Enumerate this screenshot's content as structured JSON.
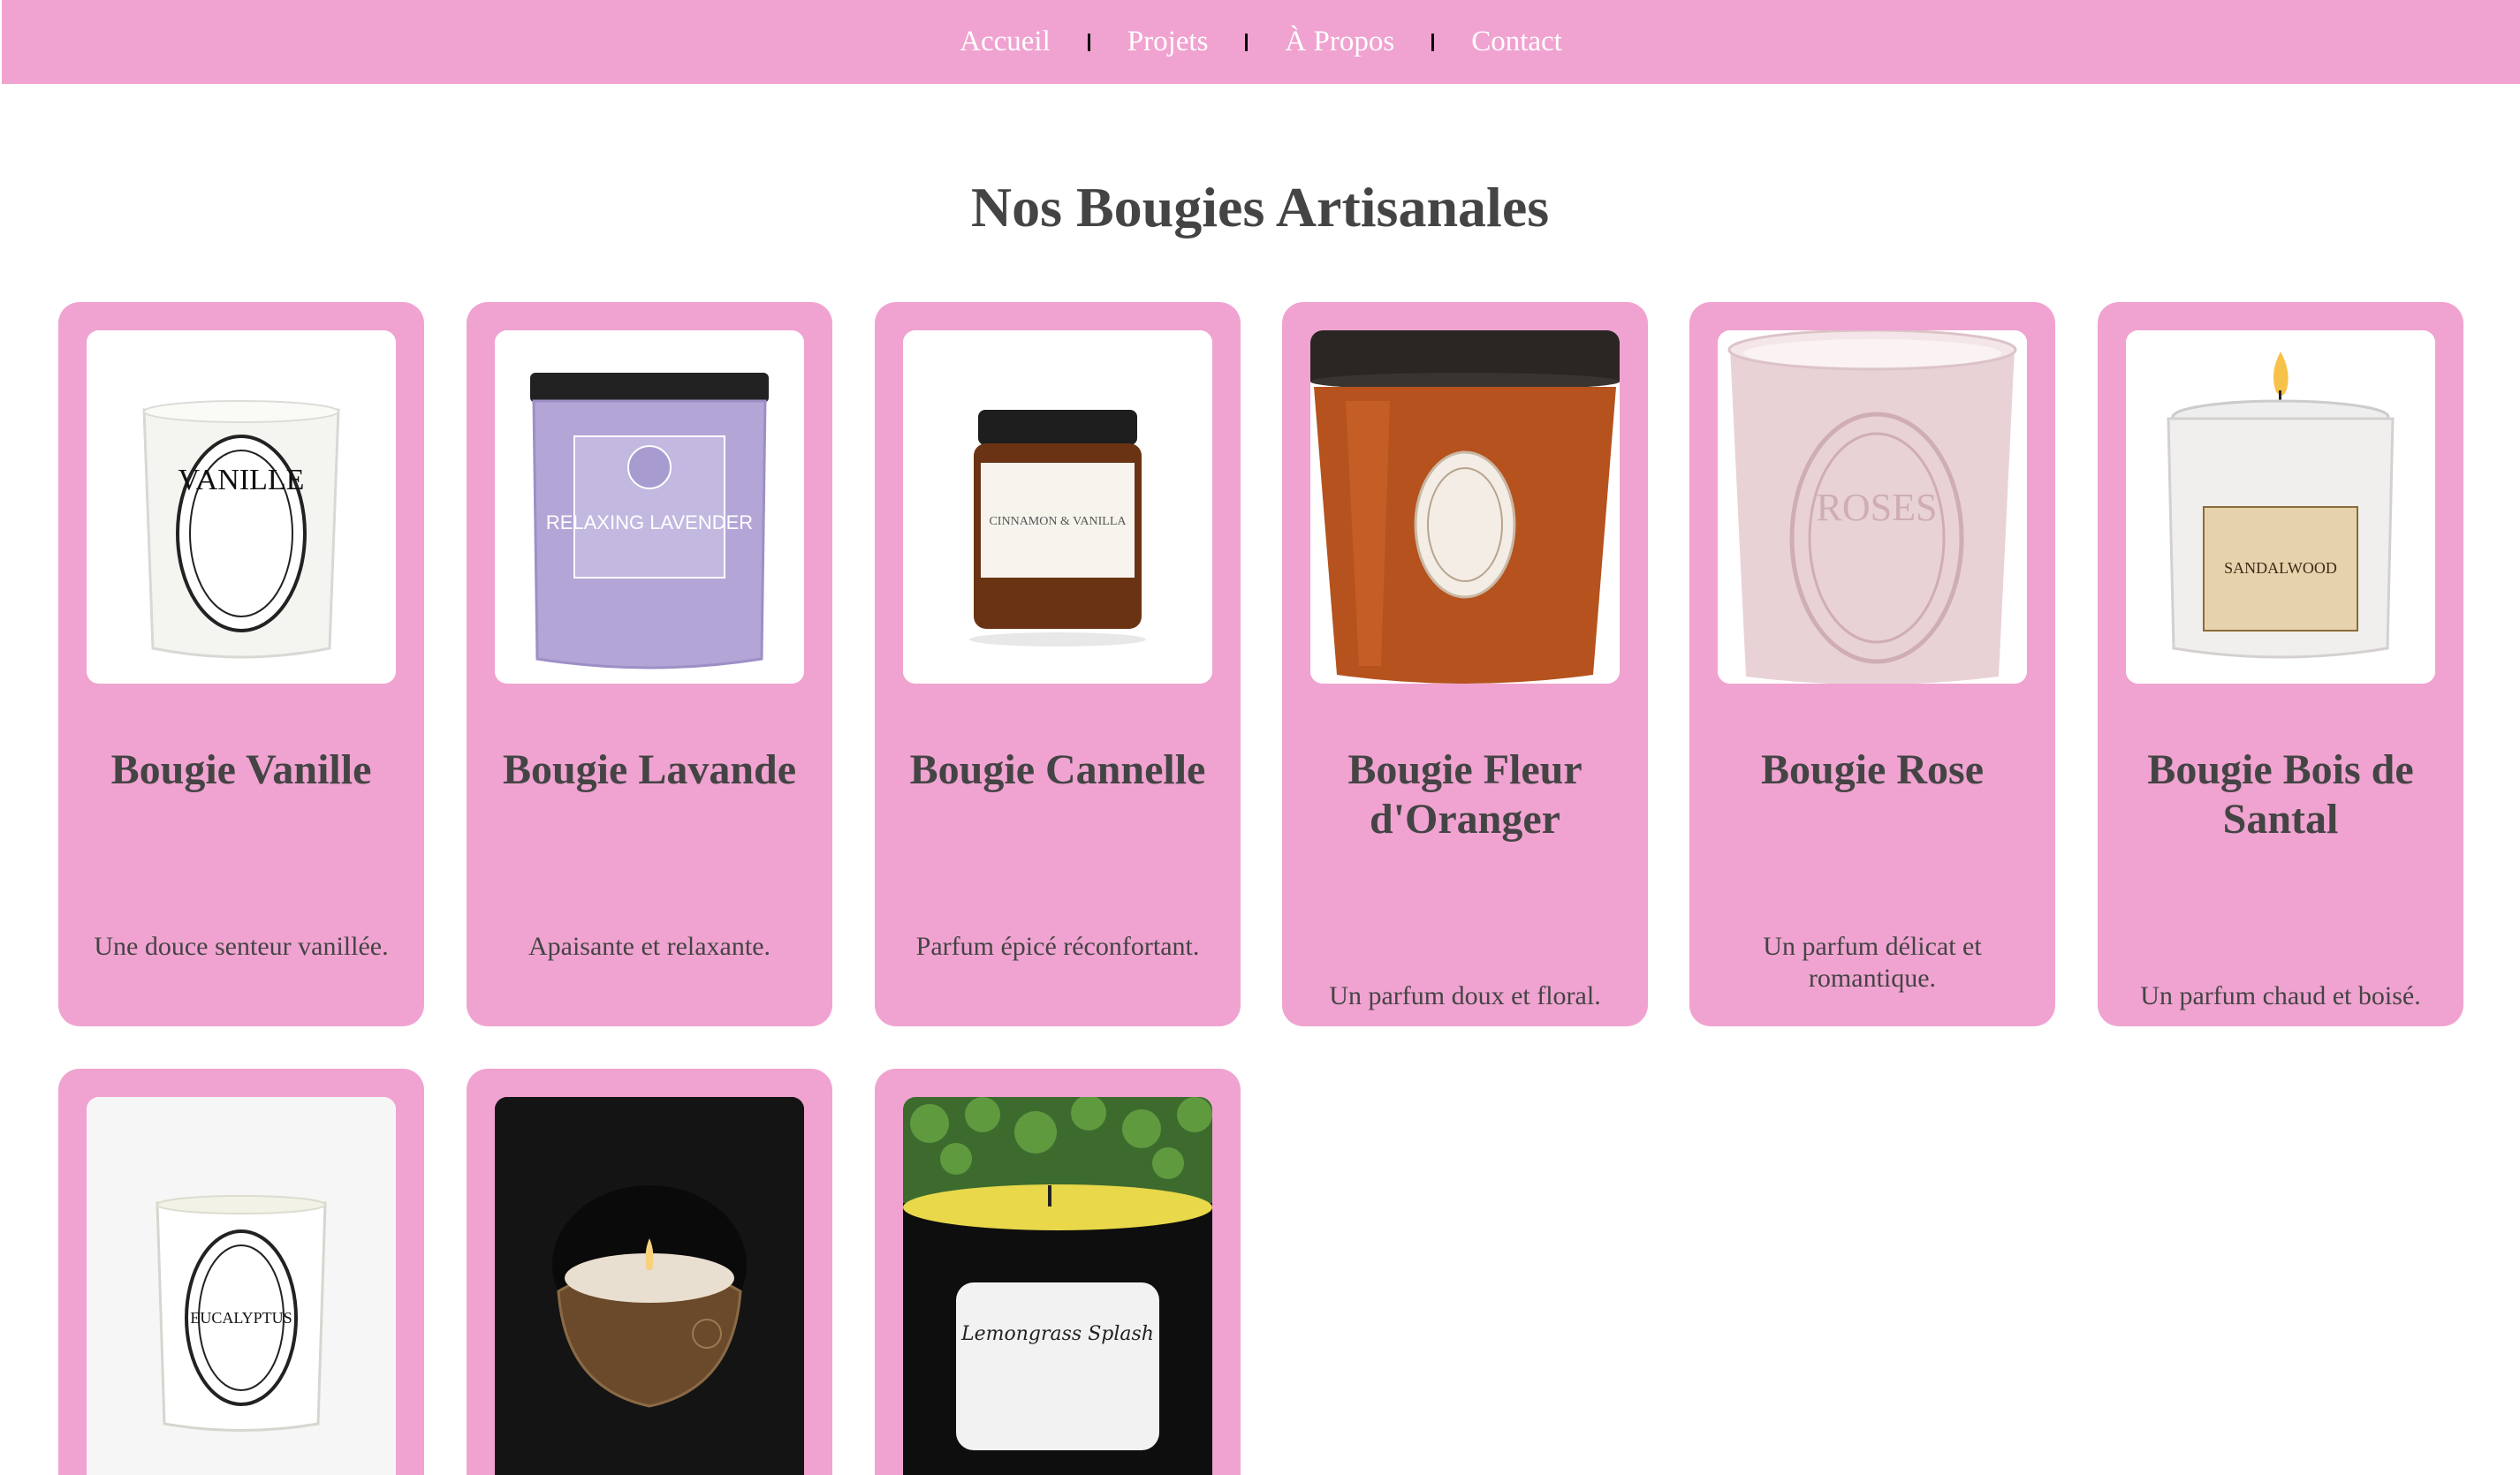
{
  "nav": {
    "items": [
      {
        "label": "Accueil"
      },
      {
        "label": "Projets"
      },
      {
        "label": "À Propos"
      },
      {
        "label": "Contact"
      }
    ]
  },
  "main": {
    "title": "Nos Bougies Artisanales"
  },
  "products": [
    {
      "name": "Bougie Vanille",
      "description": "Une douce senteur vanillée.",
      "label_text": "VANILLE"
    },
    {
      "name": "Bougie Lavande",
      "description": "Apaisante et relaxante.",
      "label_text": "RELAXING LAVENDER"
    },
    {
      "name": "Bougie Cannelle",
      "description": "Parfum épicé réconfortant.",
      "label_text": "CINNAMON & VANILLA"
    },
    {
      "name": "Bougie Fleur d'Oranger",
      "description": "Un parfum doux et floral."
    },
    {
      "name": "Bougie Rose",
      "description": "Un parfum délicat et romantique.",
      "label_text": "ROSES"
    },
    {
      "name": "Bougie Bois de Santal",
      "description": "Un parfum chaud et boisé.",
      "label_text": "SANDALWOOD"
    },
    {
      "label_text": "EUCALYPTUS"
    },
    {},
    {
      "label_text": "Lemongrass Splash"
    }
  ],
  "colors": {
    "nav_background": "#f0a3d0",
    "card_background": "#f0a3d0",
    "text": "#444444",
    "nav_text": "#ffffff"
  }
}
